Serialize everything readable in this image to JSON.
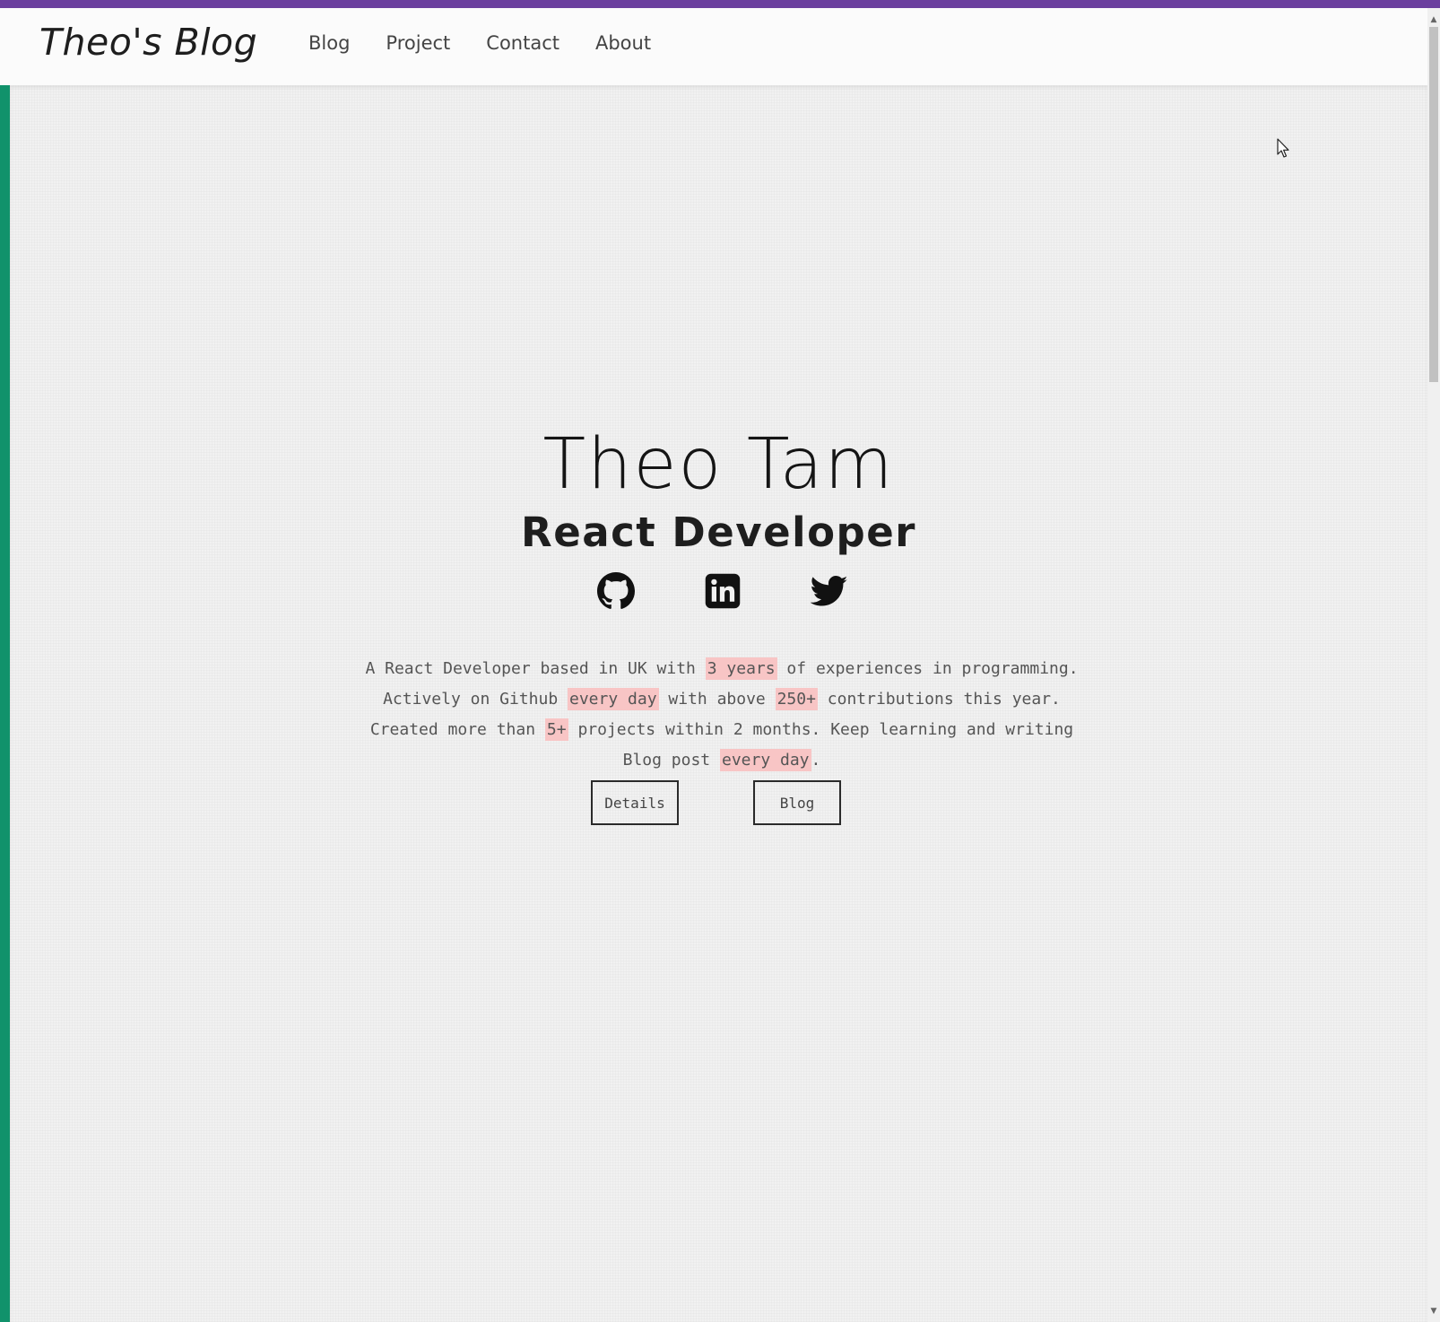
{
  "navbar": {
    "brand": "Theo's Blog",
    "links": [
      "Blog",
      "Project",
      "Contact",
      "About"
    ]
  },
  "hero": {
    "name": "Theo Tam",
    "role": "React Developer",
    "socials": [
      "github-icon",
      "linkedin-icon",
      "twitter-icon"
    ],
    "bio": [
      {
        "text": "A React Developer based in UK with ",
        "highlight": false
      },
      {
        "text": "3 years",
        "highlight": true
      },
      {
        "text": " of experiences in programming. Actively on Github ",
        "highlight": false
      },
      {
        "text": "every day",
        "highlight": true
      },
      {
        "text": " with above ",
        "highlight": false
      },
      {
        "text": "250+",
        "highlight": true
      },
      {
        "text": " contributions this year. Created more than ",
        "highlight": false
      },
      {
        "text": "5+",
        "highlight": true
      },
      {
        "text": " projects within 2 months. Keep learning and writing Blog post ",
        "highlight": false
      },
      {
        "text": "every day",
        "highlight": true
      },
      {
        "text": ".",
        "highlight": false
      }
    ],
    "buttons": {
      "details": "Details",
      "blog": "Blog"
    }
  },
  "colors": {
    "top_accent": "#6b3f9e",
    "left_rail": "#11926b",
    "highlight": "#f8c5c5",
    "hero_bg": "#f1f1f1"
  }
}
